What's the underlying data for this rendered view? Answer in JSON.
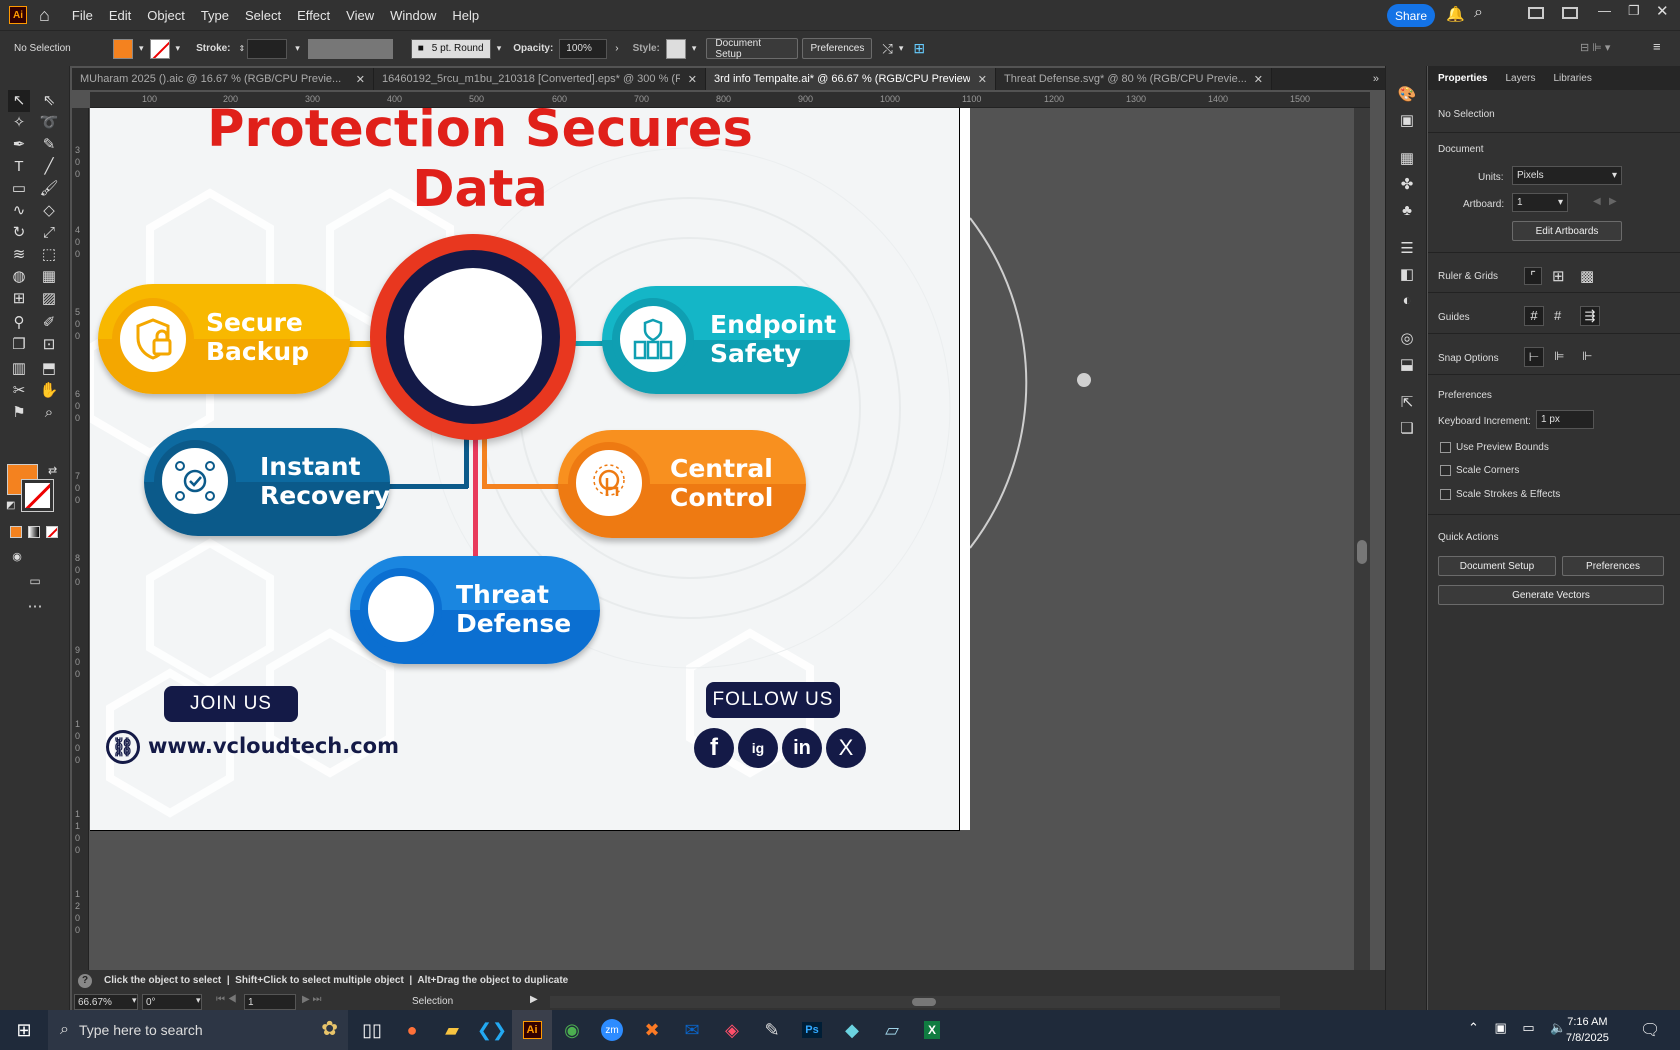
{
  "app": {
    "logo": "Ai"
  },
  "menu": [
    "File",
    "Edit",
    "Object",
    "Type",
    "Select",
    "Effect",
    "View",
    "Window",
    "Help"
  ],
  "share_label": "Share",
  "control": {
    "selection": "No Selection",
    "stroke_label": "Stroke:",
    "brush": "5 pt. Round",
    "opacity_label": "Opacity:",
    "opacity": "100%",
    "style_label": "Style:",
    "doc_setup": "Document Setup",
    "preferences": "Preferences"
  },
  "tabs": [
    {
      "label": "MUharam 2025 ().aic @ 16.67 % (RGB/CPU Previe...",
      "active": false
    },
    {
      "label": "16460192_5rcu_m1bu_210318 [Converted].eps* @ 300 % (RG...",
      "active": false
    },
    {
      "label": "3rd info Tempalte.ai* @ 66.67 % (RGB/CPU Preview)",
      "active": true
    },
    {
      "label": "Threat Defense.svg* @ 80 % (RGB/CPU Previe...",
      "active": false
    }
  ],
  "ruler": {
    "h": [
      "100",
      "200",
      "300",
      "400",
      "500",
      "600",
      "700",
      "800",
      "900",
      "1000",
      "1100",
      "1200",
      "1300",
      "1400",
      "1500"
    ],
    "v": [
      "300",
      "400",
      "500",
      "600",
      "700",
      "800",
      "900",
      "1000",
      "1100",
      "1200"
    ]
  },
  "artboard": {
    "title_line1": "Protection Secures",
    "title_line2": "Data",
    "items": {
      "secure": {
        "l1": "Secure",
        "l2": "Backup"
      },
      "endpoint": {
        "l1": "Endpoint",
        "l2": "Safety"
      },
      "instant": {
        "l1": "Instant",
        "l2": "Recovery"
      },
      "central": {
        "l1": "Central",
        "l2": "Control"
      },
      "threat": {
        "l1": "Threat",
        "l2": "Defense"
      }
    },
    "join": "JOIN US",
    "follow": "FOLLOW US",
    "website": "www.vcloudtech.com",
    "social": [
      "f",
      "ig",
      "in",
      "X"
    ]
  },
  "colors": {
    "yellow": "#f7b500",
    "teal": "#12a7b9",
    "navy": "#0b5a8a",
    "orange": "#f4821f",
    "blue": "#0b6fd1",
    "red": "#e0201a",
    "dark": "#141a47"
  },
  "status": {
    "hint": "Click the object to select  |  Shift+Click to select multiple object  |  Alt+Drag the object to duplicate",
    "zoom": "66.67%",
    "rotate": "0°",
    "artboard_num": "1",
    "tool": "Selection"
  },
  "props": {
    "tabs": [
      "Properties",
      "Layers",
      "Libraries"
    ],
    "no_selection": "No Selection",
    "document": "Document",
    "units_label": "Units:",
    "units": "Pixels",
    "artboard_label": "Artboard:",
    "artboard": "1",
    "edit_artboards": "Edit Artboards",
    "ruler_grids": "Ruler & Grids",
    "guides": "Guides",
    "snap": "Snap Options",
    "preferences": "Preferences",
    "keyboard_label": "Keyboard Increment:",
    "keyboard": "1 px",
    "use_preview": "Use Preview Bounds",
    "scale_corners": "Scale Corners",
    "scale_strokes": "Scale Strokes & Effects",
    "quick_actions": "Quick Actions",
    "doc_setup": "Document Setup",
    "prefs_btn": "Preferences",
    "gen_vectors": "Generate Vectors"
  },
  "taskbar": {
    "search": "Type here to search",
    "time": "7:16 AM",
    "date": "7/8/2025"
  }
}
